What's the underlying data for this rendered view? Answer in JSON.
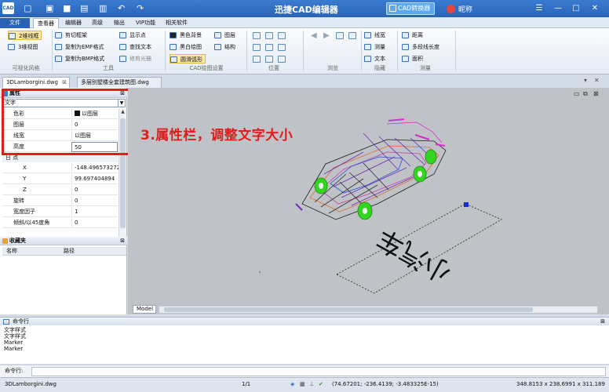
{
  "title_bar": {
    "app_icon": "CAD",
    "quick_access_icons": [
      "new-file-icon",
      "open-folder-icon",
      "save-icon",
      "save-as-icon",
      "print-icon",
      "undo-icon",
      "redo-icon"
    ],
    "title": "迅捷CAD编辑器",
    "converter_label": "CAD转换器",
    "user_name": "昵称",
    "window_controls": [
      "menu-icon",
      "minimize-icon",
      "maximize-icon",
      "close-icon"
    ]
  },
  "menu": {
    "file": "文件",
    "items": [
      "查看器",
      "编辑器",
      "高级",
      "输出",
      "VIP功能",
      "相关软件"
    ],
    "active": "查看器"
  },
  "ribbon": {
    "visual_style": {
      "btn_2d": "2维线框",
      "btn_3d": "3维视图",
      "label": "可视化风格"
    },
    "tools": {
      "clip_frame": "剪切框架",
      "copy_emf": "复制为EMF格式",
      "copy_bmp": "复制为BMP格式",
      "show_point": "显示点",
      "find_text": "查找文本",
      "trim_raster": "修剪光栅",
      "label": "工具"
    },
    "cad_draw": {
      "black_bg": "黑色背景",
      "bw_draw": "黑白绘图",
      "smooth_arc": "圆滑弧形",
      "layers": "图层",
      "structure": "结构",
      "label": "CAD绘图设置"
    },
    "position_label": "位置",
    "browse_label": "浏览",
    "hide": {
      "line_width": "线宽",
      "measure": "测量",
      "text": "文本",
      "label": "隐藏"
    },
    "measure": {
      "distance": "距离",
      "polyline_length": "多段线长度",
      "area": "面积",
      "label": "测量"
    }
  },
  "doc_tabs": [
    "3DLamborgini.dwg",
    "多层别墅楼全套建筑图.dwg"
  ],
  "properties": {
    "title": "属性",
    "object_type": "文字",
    "rows": [
      {
        "key": "色彩",
        "value": "以图层"
      },
      {
        "key": "图层",
        "value": "0"
      },
      {
        "key": "线宽",
        "value": "以图层"
      },
      {
        "key": "高度",
        "value": "50"
      }
    ],
    "point_category": "日 点",
    "point_rows": [
      {
        "key": "X",
        "value": "-148.496573272"
      },
      {
        "key": "Y",
        "value": "99.697404894"
      },
      {
        "key": "Z",
        "value": "0"
      },
      {
        "key": "旋转",
        "value": "0"
      },
      {
        "key": "宽度因子",
        "value": "1"
      },
      {
        "key": "倾斜/以45度角",
        "value": "0"
      }
    ]
  },
  "annotation": "3.属性栏，调整文字大小",
  "favorites": {
    "title": "收藏夹",
    "col_name": "名称",
    "col_path": "路径"
  },
  "canvas": {
    "model_tab": "Model",
    "drawing_text": "小汽车"
  },
  "command": {
    "title": "命令行",
    "history": [
      "文字样式",
      "文字样式",
      "Marker",
      "Marker"
    ],
    "prompt_label": "命令行:"
  },
  "status_bar": {
    "file": "3DLamborgini.dwg",
    "page": "1/1",
    "coords": "(74.67201; -236.4139; -3.483325E-15)",
    "size": "348.8153 x 238.6991 x 311.189"
  },
  "colors": {
    "accent": "#2a63b4",
    "annotation": "#e21b1b",
    "wheel": "#44dd22",
    "canvas": "#bfc3c7"
  }
}
